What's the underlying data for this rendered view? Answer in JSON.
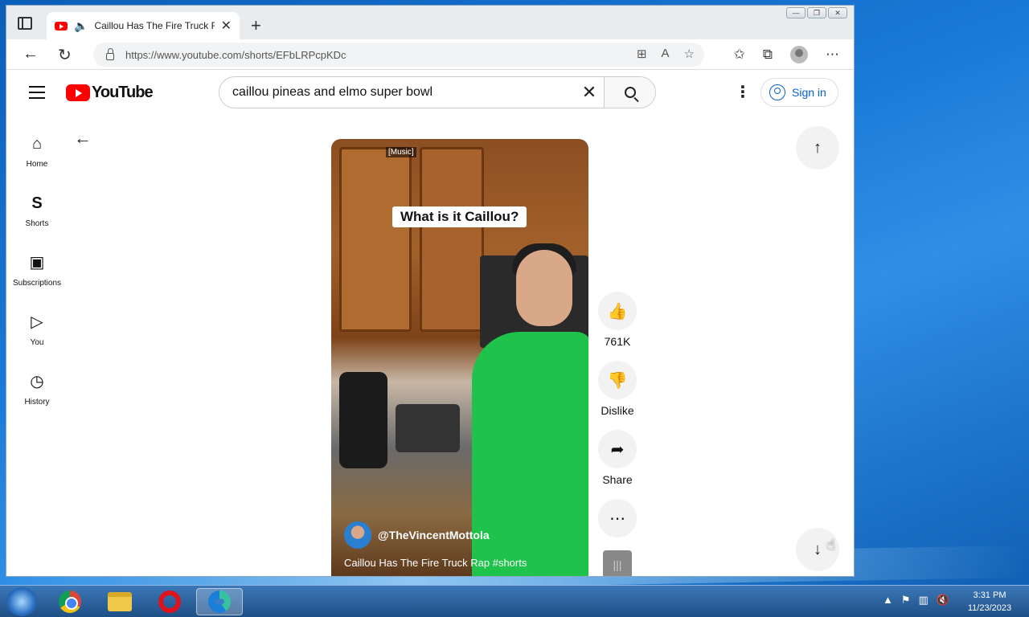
{
  "browser": {
    "tab_title": "Caillou Has The Fire Truck Rap #shorts - YouTube",
    "url": "https://www.youtube.com/shorts/EFbLRPcpKDc"
  },
  "youtube": {
    "logo_text": "YouTube",
    "search_value": "caillou pineas and elmo super bowl",
    "signin_label": "Sign in",
    "guide": [
      {
        "label": "Home",
        "icon": "home-icon"
      },
      {
        "label": "Shorts",
        "icon": "shorts-icon"
      },
      {
        "label": "Subscriptions",
        "icon": "subscriptions-icon"
      },
      {
        "label": "You",
        "icon": "you-icon"
      },
      {
        "label": "History",
        "icon": "history-icon"
      }
    ],
    "short": {
      "caption_music": "[Music]",
      "caption_main": "What is it Caillou?",
      "channel": "@TheVincentMottola",
      "title": "Caillou Has The Fire Truck Rap #shorts"
    },
    "actions": {
      "like_count": "761K",
      "dislike_label": "Dislike",
      "share_label": "Share"
    }
  },
  "taskbar": {
    "time": "3:31 PM",
    "date": "11/23/2023",
    "apps": [
      "chrome",
      "file-explorer",
      "opera",
      "edge"
    ]
  }
}
